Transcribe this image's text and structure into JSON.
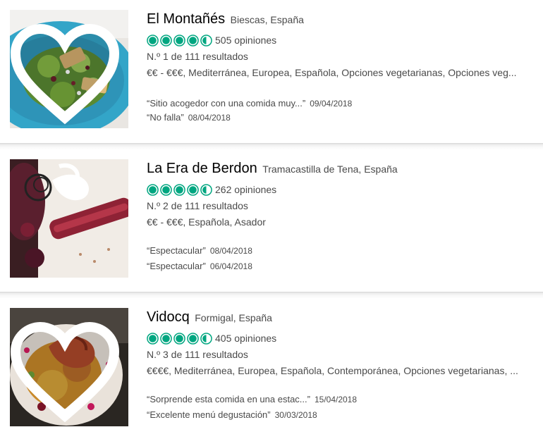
{
  "restaurants": [
    {
      "name": "El Montañés",
      "location": "Biescas, España",
      "rating": 4.5,
      "reviews": "505 opiniones",
      "rank": "N.º 1 de 111 resultados",
      "cuisine": "€€ - €€€, Mediterránea, Europea, Española, Opciones vegetarianas, Opciones veg...",
      "quotes": [
        {
          "text": "“Sitio acogedor con una comida muy...”",
          "date": "09/04/2018"
        },
        {
          "text": "“No falla”",
          "date": "08/04/2018"
        }
      ],
      "heart_icon": "heart-outline-icon"
    },
    {
      "name": "La Era de Berdon",
      "location": "Tramacastilla de Tena, España",
      "rating": 4.5,
      "reviews": "262 opiniones",
      "rank": "N.º 2 de 111 resultados",
      "cuisine": "€€ - €€€, Española, Asador",
      "quotes": [
        {
          "text": "“Espectacular”",
          "date": "08/04/2018"
        },
        {
          "text": "“Espectacular”",
          "date": "06/04/2018"
        }
      ]
    },
    {
      "name": "Vidocq",
      "location": "Formigal, España",
      "rating": 4.5,
      "reviews": "405 opiniones",
      "rank": "N.º 3 de 111 resultados",
      "cuisine": "€€€€, Mediterránea, Europea, Española, Contemporánea, Opciones vegetarianas, ...",
      "quotes": [
        {
          "text": "“Sorprende esta comida en una estac...”",
          "date": "15/04/2018"
        },
        {
          "text": "“Excelente menú degustación”",
          "date": "30/03/2018"
        }
      ],
      "heart_icon": "heart-outline-icon"
    }
  ],
  "colors": {
    "bubble_green": "#00a680",
    "text_secondary": "#4a4a4a",
    "title": "#000000"
  }
}
